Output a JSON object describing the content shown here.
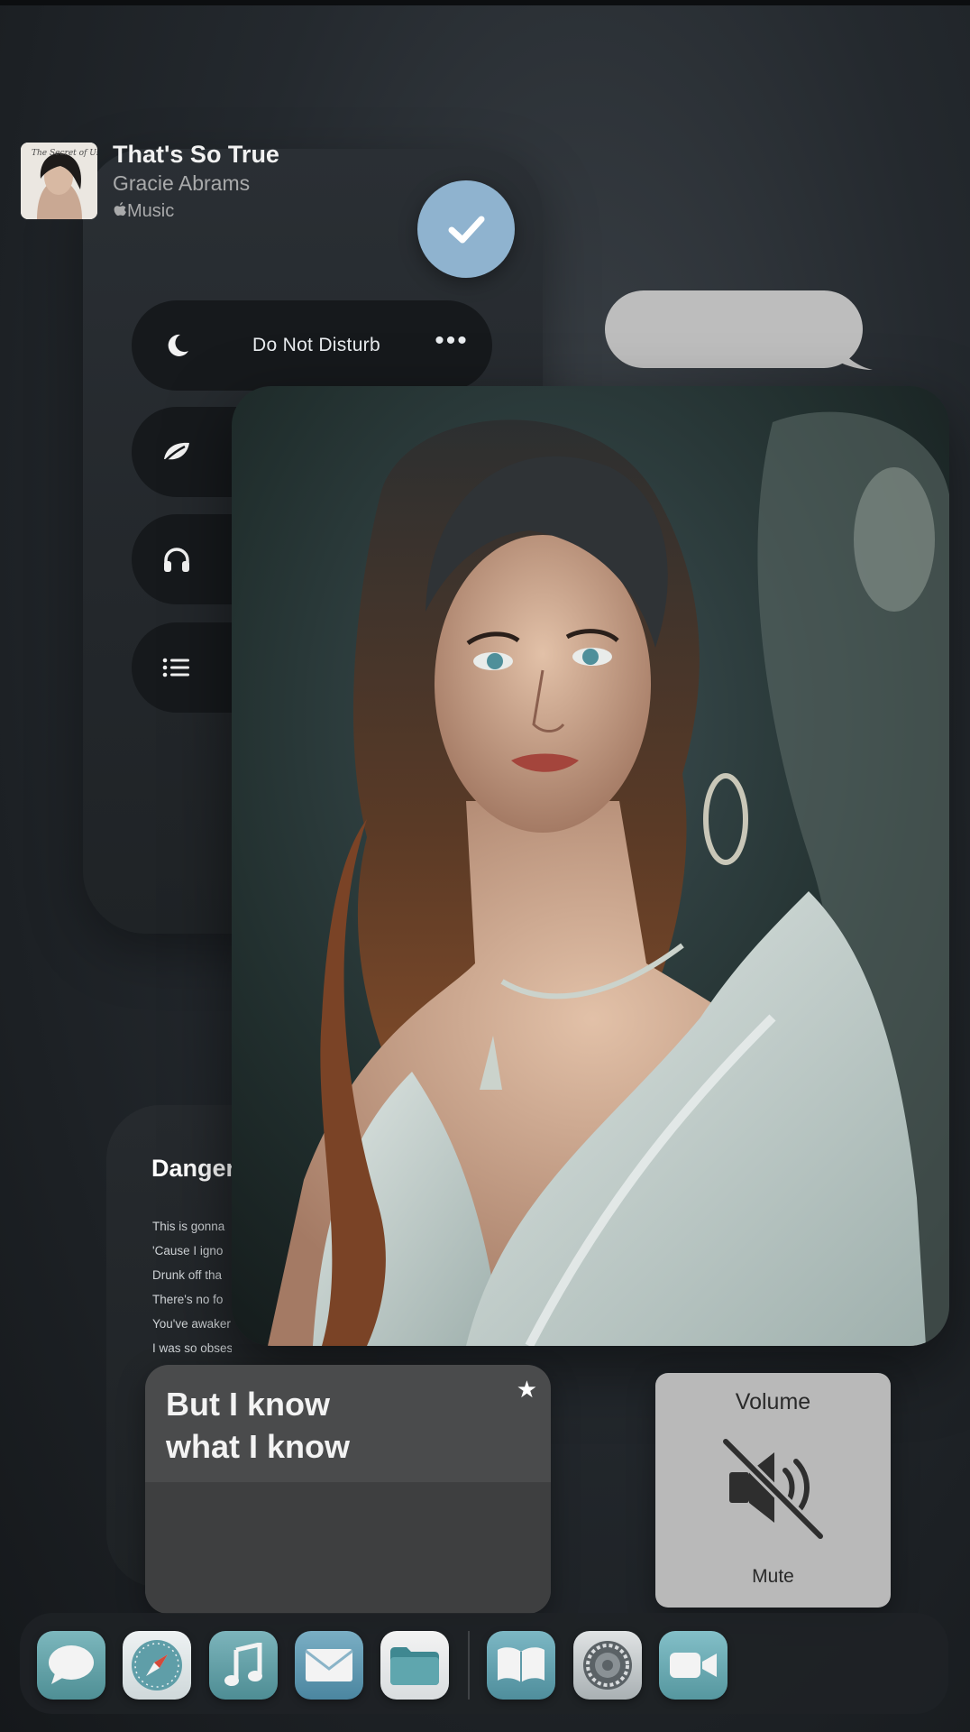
{
  "focus": {
    "items": [
      {
        "icon": "moon-icon",
        "label": "Do Not Disturb"
      },
      {
        "icon": "leaf-icon",
        "label": ""
      },
      {
        "icon": "headphones-icon",
        "label": ""
      },
      {
        "icon": "list-icon",
        "label": ""
      }
    ],
    "more_label": "•••"
  },
  "lyrics": {
    "title": "Danger",
    "lines": [
      "This is gonna",
      "'Cause I igno",
      "Drunk off tha",
      "There's no fo",
      "You've awaker",
      "I was so obsessed"
    ]
  },
  "now_playing": {
    "lyric_line1": "But I know",
    "lyric_line2": "what I know",
    "song": "That's So True",
    "artist": "Gracie Abrams",
    "source": "Music",
    "star": "★"
  },
  "volume": {
    "title": "Volume",
    "status": "Mute"
  },
  "dock": {
    "apps": [
      "Messages",
      "Safari",
      "Music",
      "Mail",
      "Files",
      "Books",
      "Settings",
      "FaceTime"
    ]
  },
  "colors": {
    "accent_check": "#8fb3cf",
    "dock_icon": "#6fa6b4"
  }
}
